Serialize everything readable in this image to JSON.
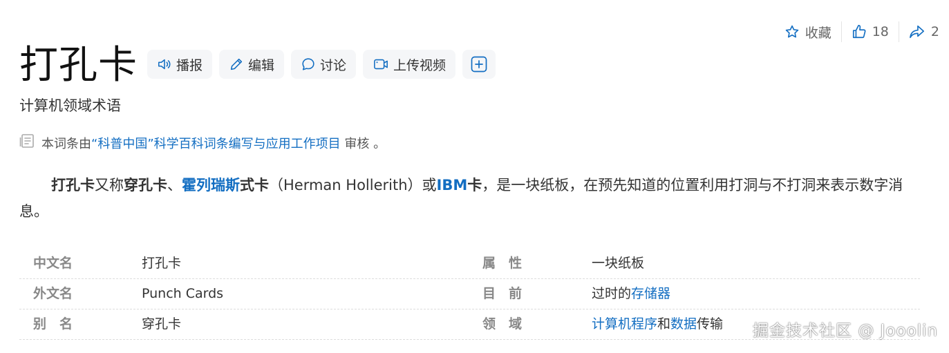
{
  "top_actions": {
    "favorite_label": "收藏",
    "like_count": "18",
    "share_count": "2"
  },
  "entry": {
    "title": "打孔卡",
    "subtitle": "计算机领域术语"
  },
  "toolbar": {
    "broadcast_label": "播报",
    "edit_label": "编辑",
    "discuss_label": "讨论",
    "upload_video_label": "上传视频"
  },
  "review": {
    "prefix": "本词条由",
    "project_link": "“科普中国”科学百科词条编写与应用工作项目",
    "suffix": " 审核 。"
  },
  "summary": {
    "term1": "打孔卡",
    "t1": "又称",
    "term2": "穿孔卡",
    "t2": "、",
    "term3_link": "霍列瑞斯",
    "term3_rest": "式卡",
    "t3": "（Herman Hollerith）或",
    "term4_link": "IBM",
    "term4_rest": "卡",
    "t4": "，是一块纸板，在预先知道的位置利用打洞与不打洞来表示数字消息。"
  },
  "basic_info": [
    {
      "key1": "中文名",
      "val1": "打孔卡",
      "key2": "属　性",
      "val2": "一块纸板"
    },
    {
      "key1": "外文名",
      "val1": "Punch Cards",
      "key2": "目　前",
      "val2_prefix": "过时的",
      "val2_link": "存储器"
    },
    {
      "key1": "别　名",
      "val1": "穿孔卡",
      "key2": "领　域",
      "val2_link": "计算机程序",
      "val2_mid": "和",
      "val2_link2": "数据",
      "val2_suffix": "传输"
    }
  ],
  "watermark": "掘金技术社区 @ Jooolin",
  "colors": {
    "link": "#136ec2",
    "label": "#888888",
    "text": "#333333",
    "icon": "#136ec2"
  }
}
